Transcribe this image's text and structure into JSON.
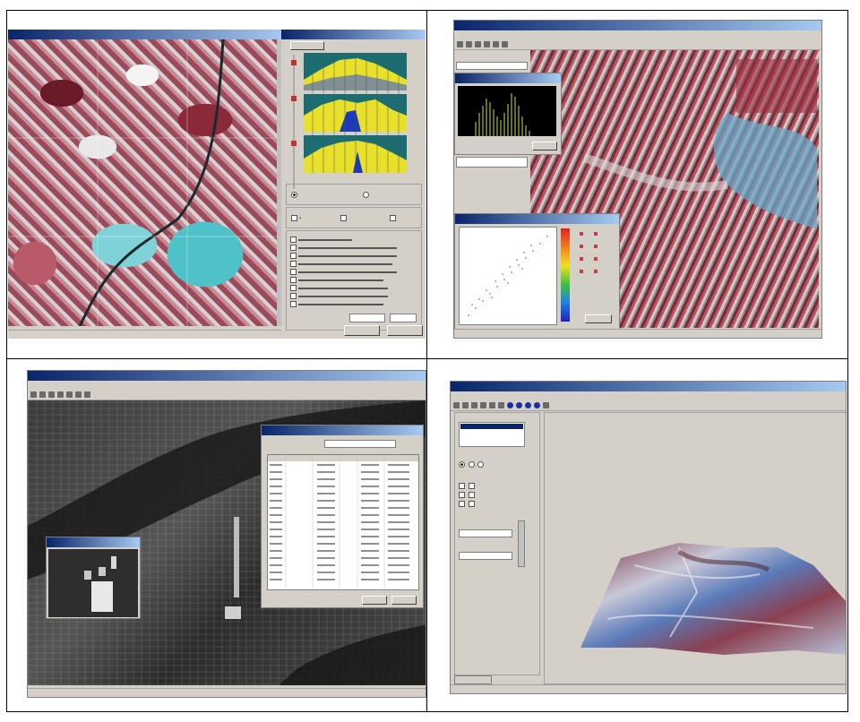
{
  "q1": {
    "left_title": "",
    "panel_title": "",
    "select_label": "",
    "groups": [
      "",
      "",
      ""
    ],
    "method_items": [
      "",
      "",
      "",
      "",
      "",
      "",
      "",
      "",
      ""
    ],
    "buttons": [
      "",
      ""
    ],
    "status": ""
  },
  "q2": {
    "title": "",
    "menu": [
      "",
      "",
      "",
      "",
      "",
      "",
      ""
    ],
    "status": ""
  },
  "q3": {
    "title": "",
    "menu": [
      "",
      "",
      "",
      "",
      "",
      "",
      "",
      "",
      ""
    ],
    "status": ""
  },
  "q4": {
    "title": "",
    "menu": [
      "",
      "",
      "",
      ""
    ],
    "panel_labels": [
      "",
      "",
      "",
      "",
      ""
    ],
    "status": ""
  },
  "colors": {
    "titlebar": "#0a246a",
    "window_bg": "#d4d0c8",
    "histogram_fill": "#e8e02a",
    "histogram_bg": "#1a6e72",
    "scatter_dots": "#d98aa0"
  }
}
